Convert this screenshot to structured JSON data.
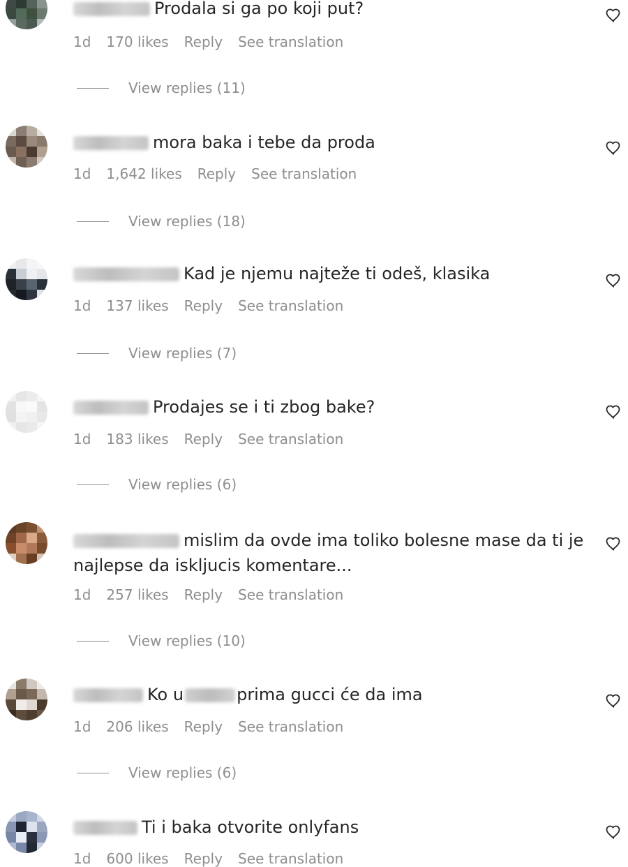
{
  "comments": [
    {
      "text": "Prodala si ga po koji put?",
      "time": "1d",
      "likes": "170 likes",
      "reply": "Reply",
      "translate": "See translation",
      "replies": "View replies (11)"
    },
    {
      "text": "mora baka i tebe da proda",
      "time": "1d",
      "likes": "1,642 likes",
      "reply": "Reply",
      "translate": "See translation",
      "replies": "View replies (18)"
    },
    {
      "text": "Kad je njemu najteže ti odeš, klasika",
      "time": "1d",
      "likes": "137 likes",
      "reply": "Reply",
      "translate": "See translation",
      "replies": "View replies (7)"
    },
    {
      "text": "Prodajes se i ti zbog bake?",
      "time": "1d",
      "likes": "183 likes",
      "reply": "Reply",
      "translate": "See translation",
      "replies": "View replies (6)"
    },
    {
      "text": "mislim da ovde ima toliko bolesne mase da ti je najlepse da iskljucis komentare...",
      "time": "1d",
      "likes": "257 likes",
      "reply": "Reply",
      "translate": "See translation",
      "replies": "View replies (10)"
    },
    {
      "text_before": "Ko u",
      "text_after": "prima gucci će da ima",
      "time": "1d",
      "likes": "206 likes",
      "reply": "Reply",
      "translate": "See translation",
      "replies": "View replies (6)"
    },
    {
      "text": "Ti i baka otvorite onlyfans",
      "time": "1d",
      "likes": "600 likes",
      "reply": "Reply",
      "translate": "See translation"
    }
  ],
  "icons": {
    "like": "heart-outline-icon",
    "avatar": "pixelated-avatar"
  },
  "colors": {
    "text": "#262626",
    "meta": "#8e8e8e",
    "background": "#ffffff"
  }
}
